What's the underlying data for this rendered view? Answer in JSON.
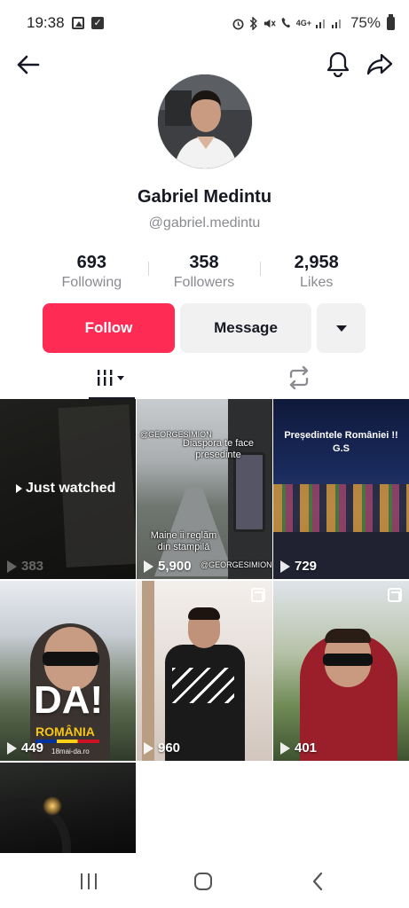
{
  "status_bar": {
    "time": "19:38",
    "battery": "75%",
    "network": "4G+"
  },
  "header": {
    "back_icon": "arrow-left-icon",
    "bell_icon": "bell-icon",
    "share_icon": "share-icon"
  },
  "profile": {
    "name": "Gabriel Medintu",
    "handle": "@gabriel.medintu",
    "stats": [
      {
        "value": "693",
        "label": "Following"
      },
      {
        "value": "358",
        "label": "Followers"
      },
      {
        "value": "2,958",
        "label": "Likes"
      }
    ]
  },
  "actions": {
    "follow": "Follow",
    "message": "Message"
  },
  "colors": {
    "accent": "#fe2c55",
    "button_bg": "#f1f1f2",
    "secondary_text": "#8a8b91"
  },
  "videos": [
    {
      "views": "383",
      "overlay": "Just watched"
    },
    {
      "views": "5,900",
      "caption_top_tag": "@GEORGESIMION",
      "caption_top": "Diaspora te face presedinte",
      "caption_bottom": "Maine ii reglăm din stampilă",
      "caption_bottom_tag": "@GEORGESIMION"
    },
    {
      "views": "729",
      "caption": "Președintele României !!",
      "caption2": "G.S"
    },
    {
      "views": "449",
      "big_text": "DA!",
      "sub_text": "ROMÂNIA",
      "site": "18mai-da.ro"
    },
    {
      "views": "960"
    },
    {
      "views": "401"
    },
    {
      "views": ""
    }
  ]
}
